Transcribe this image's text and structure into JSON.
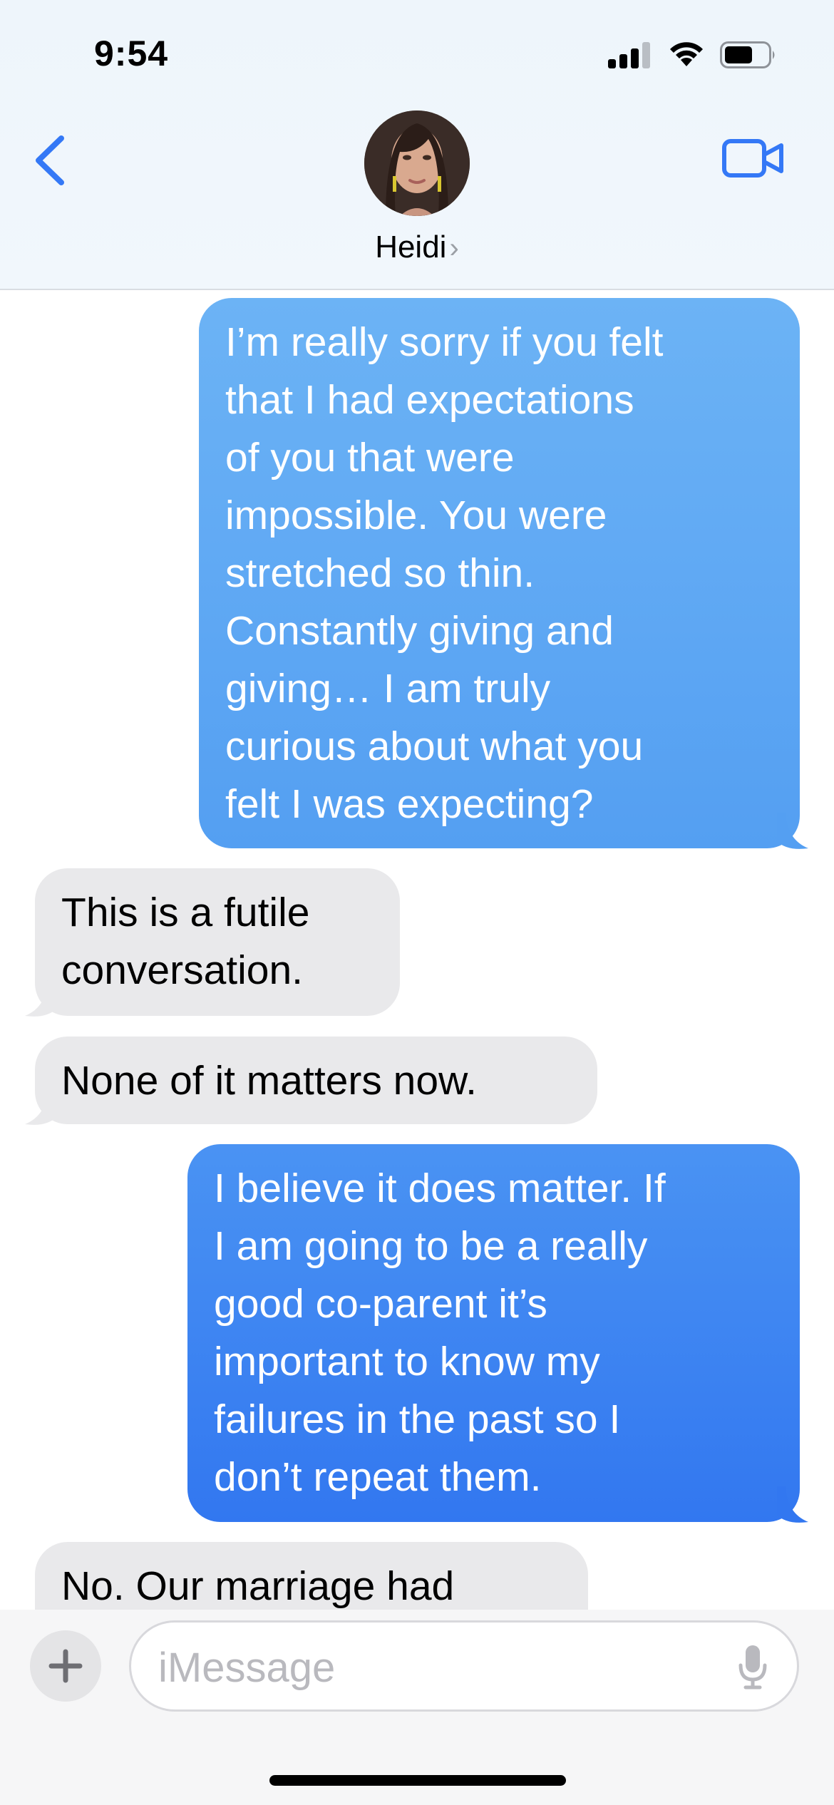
{
  "status_bar": {
    "time": "9:54"
  },
  "header": {
    "contact_name": "Heidi",
    "name_chevron": "›",
    "back_icon": "chevron-left-icon",
    "video_icon": "video-camera-icon",
    "accent_color": "#3478f6"
  },
  "messages": [
    {
      "direction": "sent",
      "text": "I’m really sorry if you felt\nthat I had expectations\nof you that were\nimpossible. You were\nstretched so thin.\nConstantly giving and\ngiving… I am truly\ncurious about what you\nfelt I was expecting?"
    },
    {
      "direction": "received",
      "text": "This is a futile\nconversation."
    },
    {
      "direction": "received",
      "text": "None of it matters now."
    },
    {
      "direction": "sent",
      "text": "I believe it does matter. If\nI am going to be a really\ngood co-parent it’s\nimportant to know my\nfailures in the past so I\ndon’t repeat them."
    },
    {
      "direction": "received",
      "text": "No. Our marriage had"
    }
  ],
  "composer": {
    "plus_label": "+",
    "placeholder": "iMessage",
    "mic_icon": "microphone-icon"
  },
  "colors": {
    "sent_bubble_top": "#6cb3f5",
    "sent_bubble_bottom": "#3277f0",
    "received_bubble": "#e9e9eb"
  }
}
